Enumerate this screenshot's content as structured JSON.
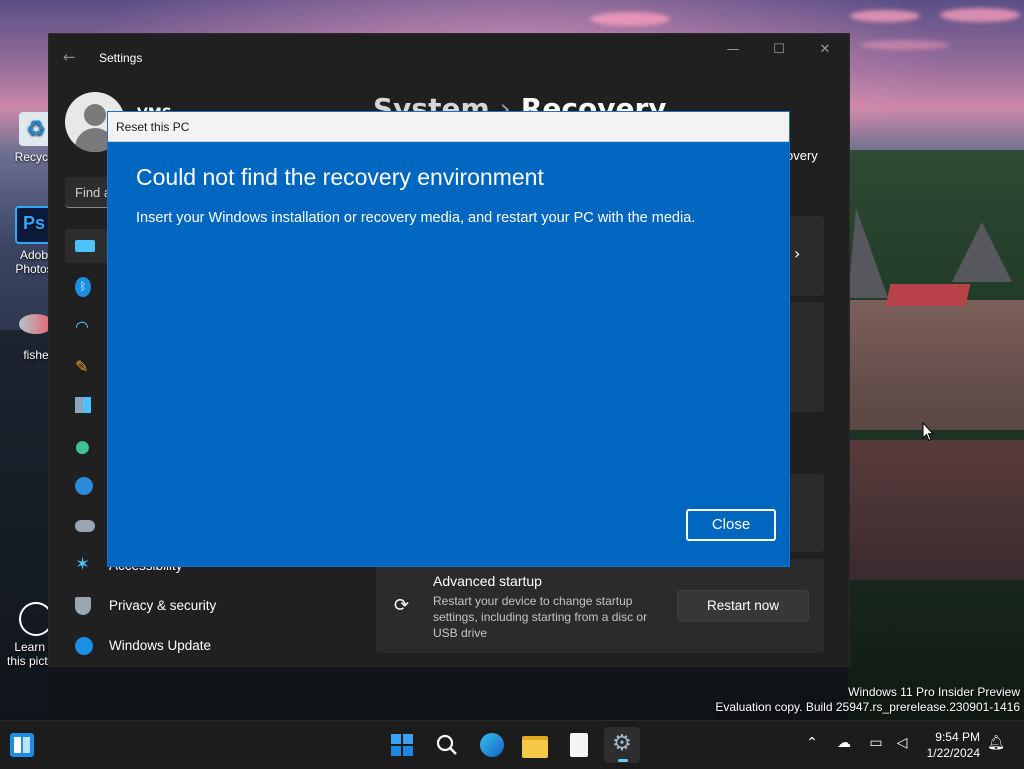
{
  "settings": {
    "title": "Settings",
    "user_name": "VMS",
    "search_placeholder": "Find a",
    "header": {
      "parent": "System",
      "separator": "›",
      "page": "Recovery"
    },
    "right_partial_text": "overy",
    "nav": [
      {
        "label": "",
        "icon": "system-icon"
      },
      {
        "label": "",
        "icon": "bluetooth-icon"
      },
      {
        "label": "",
        "icon": "network-icon"
      },
      {
        "label": "",
        "icon": "personalization-icon"
      },
      {
        "label": "",
        "icon": "apps-icon"
      },
      {
        "label": "",
        "icon": "accounts-icon"
      },
      {
        "label": "",
        "icon": "time-language-icon"
      },
      {
        "label": "",
        "icon": "gaming-icon"
      },
      {
        "label": "Accessibility",
        "icon": "accessibility-icon"
      },
      {
        "label": "Privacy & security",
        "icon": "shield-icon"
      },
      {
        "label": "Windows Update",
        "icon": "windows-update-icon"
      }
    ],
    "advanced_startup": {
      "title": "Advanced startup",
      "description": "Restart your device to change startup settings, including starting from a disc or USB drive",
      "button": "Restart now"
    }
  },
  "dialog": {
    "title": "Reset this PC",
    "heading": "Could not find the recovery environment",
    "body": "Insert your Windows installation or recovery media, and restart your PC with the media.",
    "close_button": "Close"
  },
  "desktop_icons": [
    {
      "label": "Recycle"
    },
    {
      "label": "Adob",
      "label2": "Photos"
    },
    {
      "label": "fishe"
    },
    {
      "label": "Learn al",
      "label2": "this picture"
    }
  ],
  "watermark": {
    "line1": "Windows 11 Pro Insider Preview",
    "line2": "Evaluation copy. Build 25947.rs_prerelease.230901-1416"
  },
  "taskbar": {
    "apps": [
      "widgets-icon",
      "start-icon",
      "search-icon",
      "edge-icon",
      "file-explorer-icon",
      "notepad-icon",
      "settings-icon"
    ],
    "time": "9:54 PM",
    "date": "1/22/2024"
  },
  "colors": {
    "dialog_blue": "#0067c0",
    "accent": "#60cdff",
    "settings_bg": "#202020"
  }
}
